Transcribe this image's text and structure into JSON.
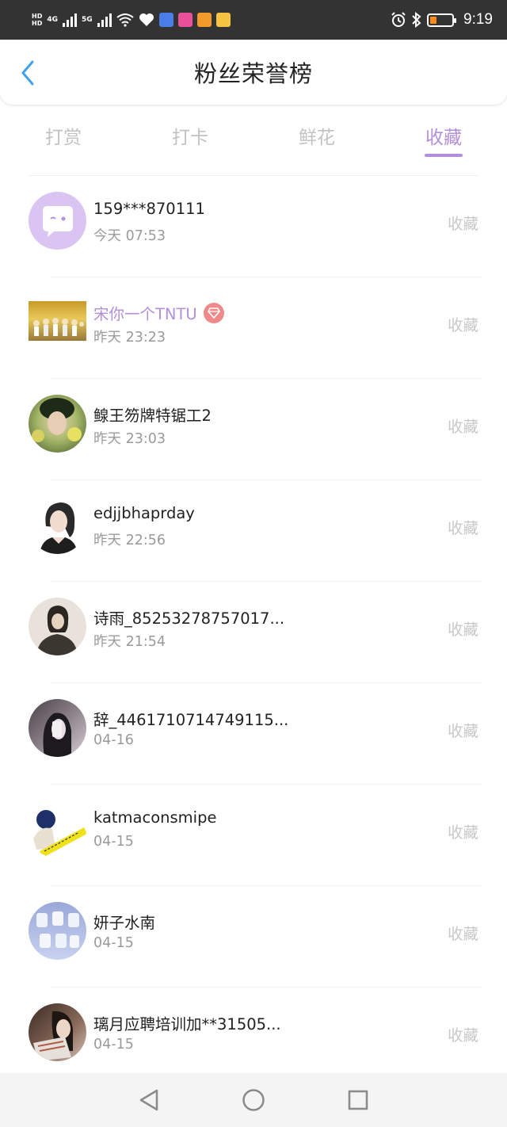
{
  "status_bar": {
    "hd1": "HD",
    "hd2": "HD",
    "net1": "4G",
    "net2": "5G",
    "time": "9:19"
  },
  "header": {
    "title": "粉丝荣誉榜"
  },
  "tabs": [
    {
      "label": "打赏",
      "active": false
    },
    {
      "label": "打卡",
      "active": false
    },
    {
      "label": "鲜花",
      "active": false
    },
    {
      "label": "收藏",
      "active": true
    }
  ],
  "list": [
    {
      "name": "159***870111",
      "time": "今天 07:53",
      "action": "收藏",
      "vip": false
    },
    {
      "name": "宋你一个TNTU",
      "time": "昨天 23:23",
      "action": "收藏",
      "vip": true
    },
    {
      "name": "鳈王笏牌特锯工2",
      "time": "昨天 23:03",
      "action": "收藏",
      "vip": false
    },
    {
      "name": "edjjbhaprday",
      "time": "昨天 22:56",
      "action": "收藏",
      "vip": false
    },
    {
      "name": "诗雨_85253278757017...",
      "time": "昨天 21:54",
      "action": "收藏",
      "vip": false
    },
    {
      "name": "辞_4461710714749115...",
      "time": "04-16",
      "action": "收藏",
      "vip": false
    },
    {
      "name": "katmaconsmipe",
      "time": "04-15",
      "action": "收藏",
      "vip": false
    },
    {
      "name": "妍子水南",
      "time": "04-15",
      "action": "收藏",
      "vip": false
    },
    {
      "name": "璃月应聘培训加**31505...",
      "time": "04-15",
      "action": "收藏",
      "vip": false
    }
  ],
  "colors": {
    "accent": "#b38fd9",
    "status_bar_bg": "#333333",
    "text_secondary": "#9a9a9a",
    "action_text": "#c8c8c8",
    "vip_badge": "#f08a8a"
  },
  "icons": {
    "back": "chevron-left-icon",
    "nav_back": "triangle-back-icon",
    "nav_home": "circle-home-icon",
    "nav_recent": "square-recent-icon"
  }
}
